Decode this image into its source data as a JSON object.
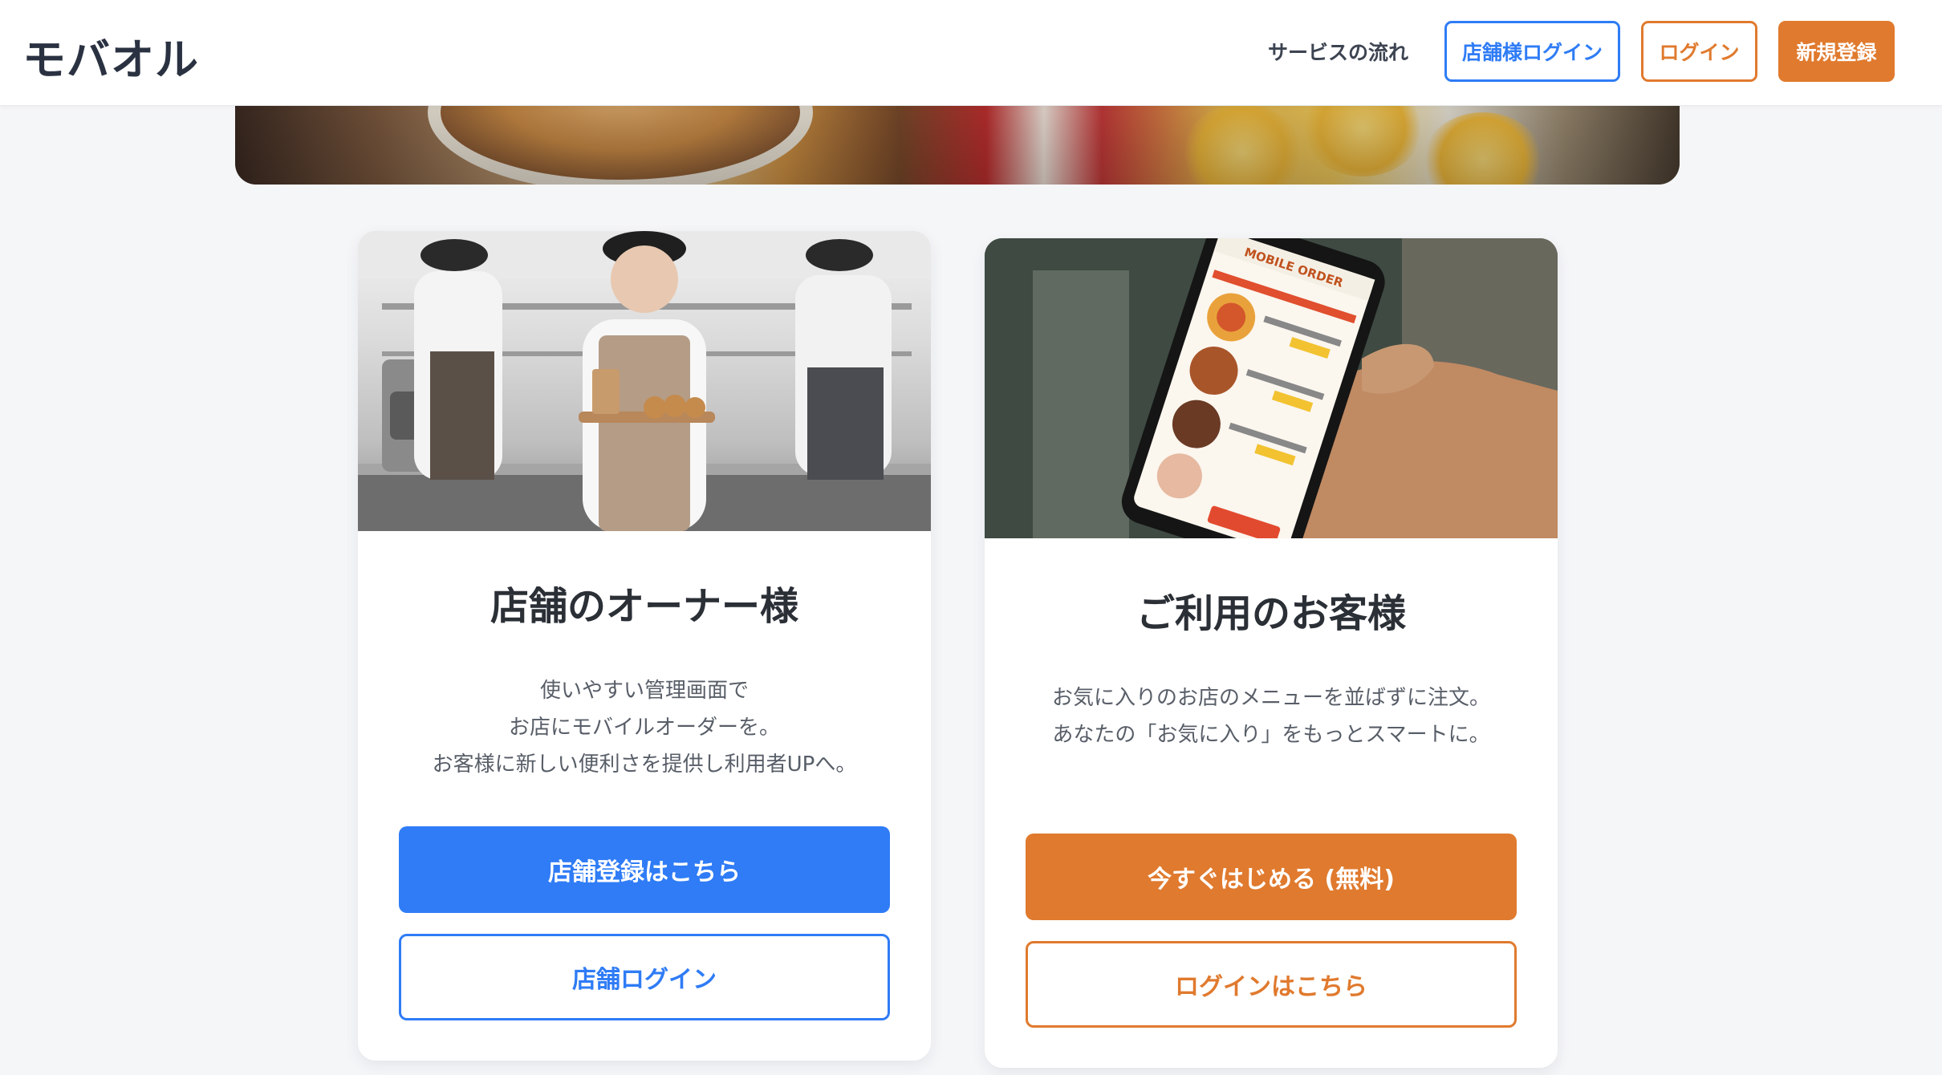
{
  "header": {
    "logo": "モバオル",
    "nav_flow": "サービスの流れ",
    "store_login": "店舗様ログイン",
    "login": "ログイン",
    "signup": "新規登録"
  },
  "colors": {
    "brand_blue": "#2f7cf6",
    "brand_orange": "#e07a2e",
    "text_dark": "#2b2f36",
    "text_muted": "#585e68"
  },
  "owner_card": {
    "image_icon": "cafe-staff-photo",
    "title": "店舗のオーナー様",
    "desc": [
      "使いやすい管理画面で",
      "お店にモバイルオーダーを。",
      "お客様に新しい便利さを提供し利用者UPへ。"
    ],
    "primary_button": "店舗登録はこちら",
    "secondary_button": "店舗ログイン"
  },
  "customer_card": {
    "image_icon": "mobile-order-phone-photo",
    "phone_screen_title": "MOBILE ORDER",
    "title": "ご利用のお客様",
    "desc": [
      "お気に入りのお店のメニューを並ばずに注文。",
      "あなたの「お気に入り」をもっとスマートに。"
    ],
    "primary_button": "今すぐはじめる (無料)",
    "secondary_button": "ログインはこちら"
  }
}
